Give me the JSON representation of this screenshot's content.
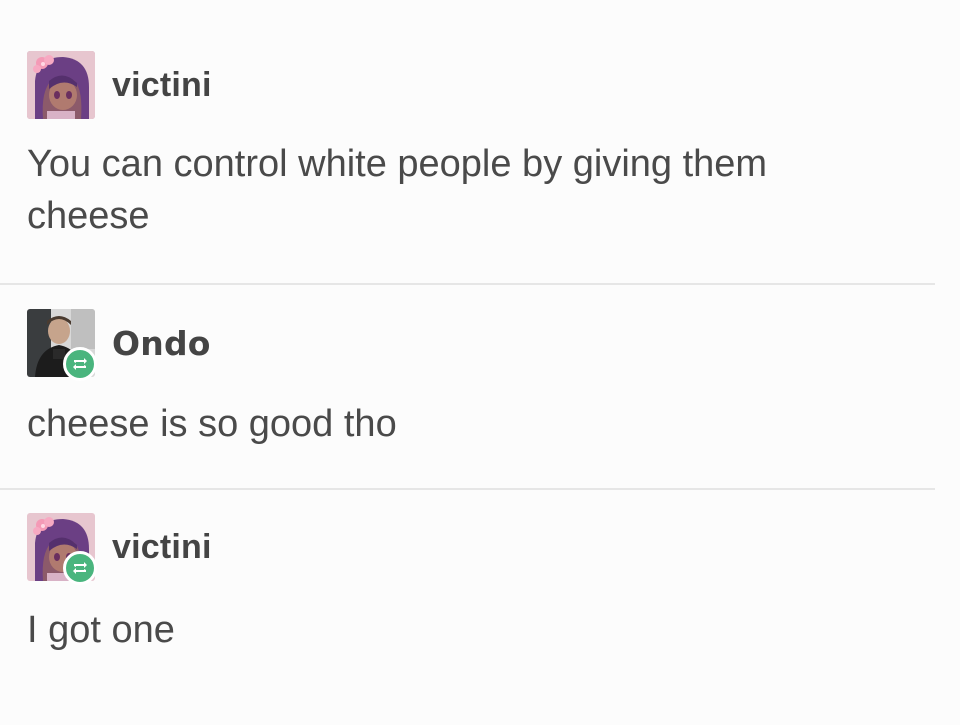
{
  "posts": [
    {
      "username": "victini",
      "avatar_icon": "anime-girl-avatar-icon",
      "reblogged": false,
      "body": "You can control white people by giving them\ncheese"
    },
    {
      "username": "Ondo",
      "avatar_icon": "person-photo-avatar-icon",
      "reblogged": true,
      "body": "cheese is so good tho"
    },
    {
      "username": "victini",
      "avatar_icon": "anime-girl-avatar-icon",
      "reblogged": true,
      "body": "I got one"
    }
  ],
  "colors": {
    "reblog_badge": "#4ab57e",
    "text": "#444444",
    "divider": "#e6e6e6",
    "background": "#fcfcfc"
  }
}
